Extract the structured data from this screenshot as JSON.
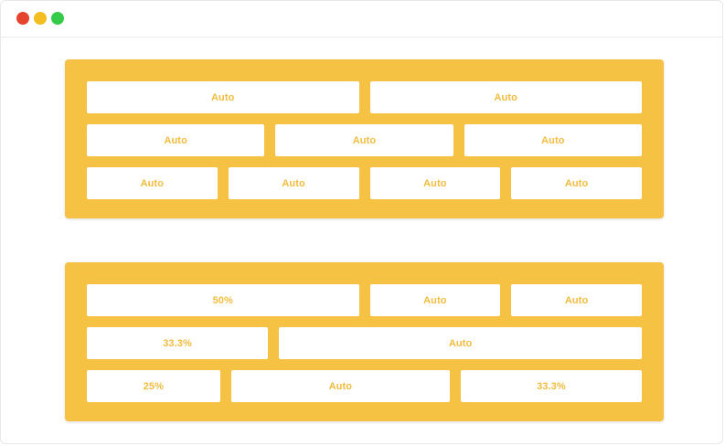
{
  "window": {
    "controls": [
      {
        "name": "close-button",
        "color": "#e5452f"
      },
      {
        "name": "minimize-button",
        "color": "#f4be20"
      },
      {
        "name": "maximize-button",
        "color": "#35cb49"
      }
    ]
  },
  "colors": {
    "panel_bg": "#f6c244",
    "cell_text": "#f2bc3f"
  },
  "panel_top": {
    "rows": [
      [
        "Auto",
        "Auto"
      ],
      [
        "Auto",
        "Auto",
        "Auto"
      ],
      [
        "Auto",
        "Auto",
        "Auto",
        "Auto"
      ]
    ]
  },
  "panel_bottom": {
    "rows": [
      [
        "50%",
        "Auto",
        "Auto"
      ],
      [
        "33.3%",
        "Auto"
      ],
      [
        "25%",
        "Auto",
        "33.3%"
      ]
    ]
  }
}
